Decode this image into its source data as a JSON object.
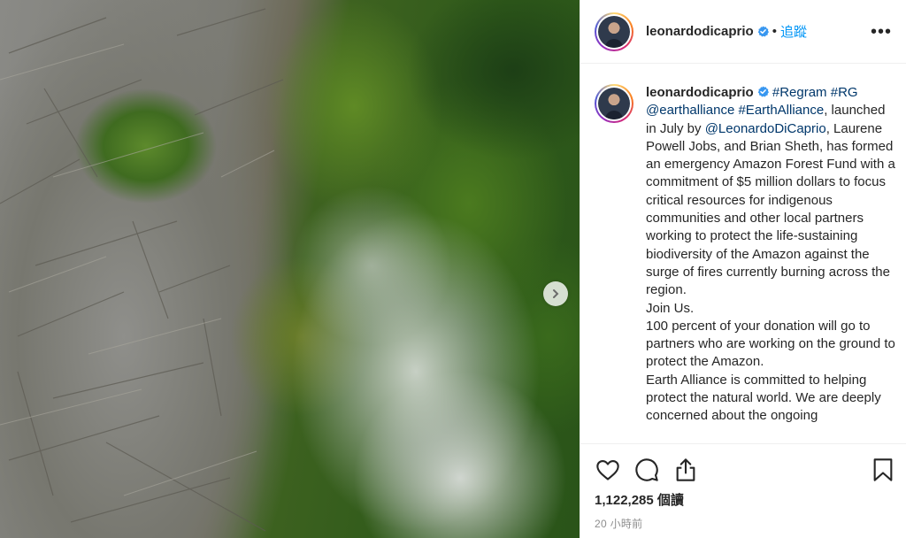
{
  "post": {
    "username": "leonardodicaprio",
    "follow_label": "追蹤",
    "separator": "•",
    "more_label": "•••"
  },
  "caption": {
    "username": "leonardodicaprio",
    "tag_regram": "#Regram",
    "tag_rg": "#RG",
    "mention_earthalliance": "@earthalliance",
    "tag_earthalliance": "#EarthAlliance",
    "text_1a": "launched in July by",
    "mention_leo": "@LeonardoDiCaprio",
    "text_1b": ", Laurene Powell Jobs, and Brian Sheth, has formed an emergency Amazon Forest Fund with a commitment of $5 million dollars to focus critical resources for indigenous communities and other local partners working to protect the life-sustaining biodiversity of the Amazon against the surge of fires currently burning across the region.",
    "text_2": "Join Us.",
    "text_3": "100 percent of your donation will go to partners who are working on the ground to protect the Amazon.",
    "text_4": "Earth Alliance is committed to helping protect the natural world. We are deeply concerned about the ongoing"
  },
  "stats": {
    "views": "1,122,285 個讀",
    "time_ago": "20 小時前"
  },
  "icons": {
    "like": "heart-icon",
    "comment": "comment-icon",
    "share": "share-icon",
    "save": "bookmark-icon",
    "verified": "verified-badge-icon",
    "next": "chevron-right-icon"
  },
  "colors": {
    "link": "#00376b",
    "follow": "#0095f6",
    "verified": "#3897f0",
    "muted": "#8e8e8e"
  }
}
